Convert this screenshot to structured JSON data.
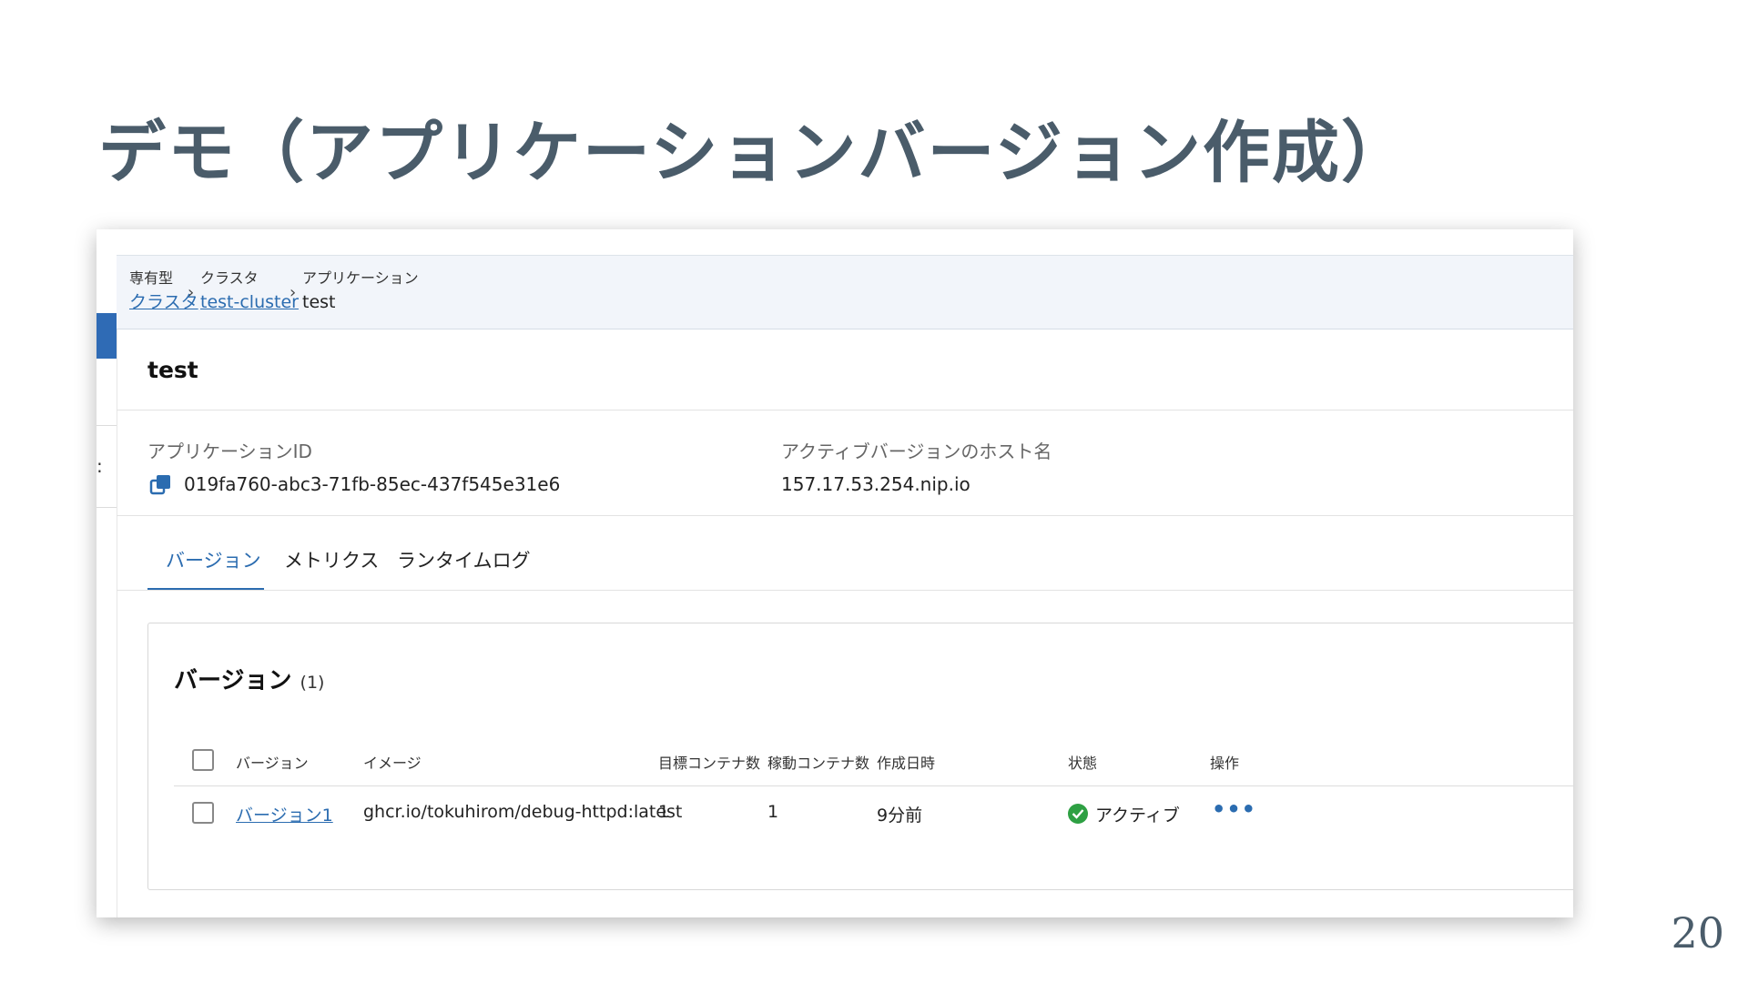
{
  "slide": {
    "title": "デモ（アプリケーションバージョン作成）",
    "page_number": "20"
  },
  "breadcrumb": [
    {
      "label": "専有型",
      "link": "クラスタ"
    },
    {
      "label": "クラスタ",
      "link": "test-cluster"
    },
    {
      "label": "アプリケーション",
      "current": "test"
    }
  ],
  "app": {
    "title": "test",
    "id_label": "アプリケーションID",
    "id_value": "019fa760-abc3-71fb-85ec-437f545e31e6",
    "host_label": "アクティブバージョンのホスト名",
    "host_value": "157.17.53.254.nip.io"
  },
  "tabs": [
    {
      "label": "バージョン",
      "active": true
    },
    {
      "label": "メトリクス",
      "active": false
    },
    {
      "label": "ランタイムログ",
      "active": false
    }
  ],
  "versions_panel": {
    "title": "バージョン",
    "count": "(1)",
    "columns": [
      "バージョン",
      "イメージ",
      "目標コンテナ数",
      "稼動コンテナ数",
      "作成日時",
      "状態",
      "操作"
    ],
    "rows": [
      {
        "version": "バージョン1",
        "image": "ghcr.io/tokuhirom/debug-httpd:latest",
        "target_containers": "1",
        "running_containers": "1",
        "created": "9分前",
        "status": "アクティブ"
      }
    ]
  },
  "colors": {
    "accent": "#2b6cb0",
    "status_active": "#2ea043",
    "title": "#4a5c6a"
  },
  "icons": [
    "copy-icon",
    "chevron-right-icon",
    "check-circle-icon",
    "more-icon"
  ]
}
